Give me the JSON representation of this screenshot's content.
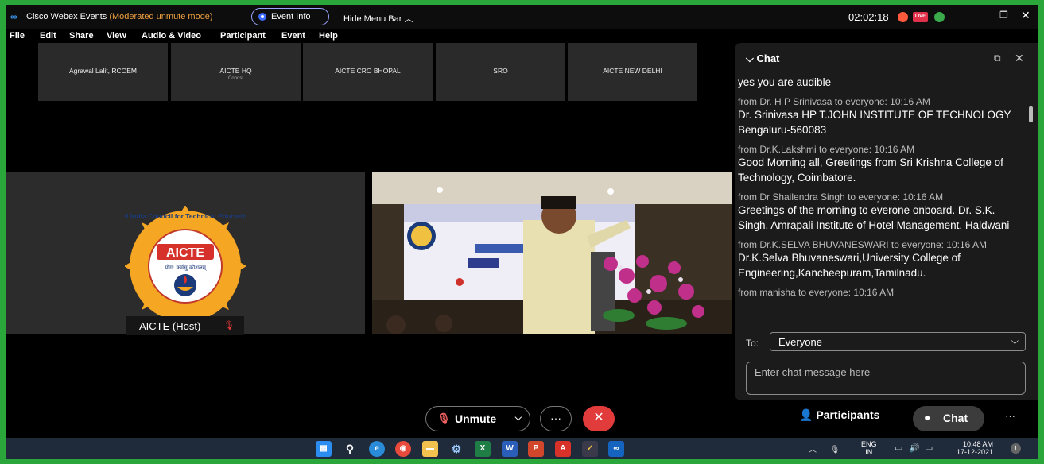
{
  "app": {
    "title": "Cisco Webex Events",
    "mode": "(Moderated unmute mode)",
    "event_info": "Event Info",
    "hide_menu": "Hide Menu Bar",
    "timer": "02:02:18",
    "live_badge": "LIVE"
  },
  "menu": [
    "File",
    "Edit",
    "Share",
    "View",
    "Audio & Video",
    "Participant",
    "Event",
    "Help"
  ],
  "thumbnails": [
    {
      "name": "Agrawal Lalit, RCOEM",
      "sub": ""
    },
    {
      "name": "AICTE HQ",
      "sub": "Cohost"
    },
    {
      "name": "AICTE CRO BHOPAL",
      "sub": ""
    },
    {
      "name": "SRO",
      "sub": ""
    },
    {
      "name": "AICTE NEW DELHI",
      "sub": ""
    }
  ],
  "stage": {
    "host_label": "AICTE (Host)",
    "logo_text": "AICTE",
    "logo_ring": "All India Council for Technical Education",
    "logo_motto": "योग: कर्मसु कौशलम्"
  },
  "chat": {
    "title": "Chat",
    "messages": [
      {
        "meta": "",
        "body": "yes you are audible"
      },
      {
        "meta": "from Dr. H P Srinivasa to everyone:   10:16 AM",
        "body": "Dr. Srinivasa HP T.JOHN INSTITUTE OF TECHNOLOGY Bengaluru-560083"
      },
      {
        "meta": "from Dr.K.Lakshmi to everyone:   10:16 AM",
        "body": "Good Morning all, Greetings from Sri Krishna College of Technology, Coimbatore."
      },
      {
        "meta": "from Dr Shailendra Singh to everyone:   10:16 AM",
        "body": "Greetings of the morning to everone onboard. Dr. S.K. Singh, Amrapali Institute of Hotel Management, Haldwani"
      },
      {
        "meta": "from Dr.K.SELVA BHUVANESWARI to everyone:   10:16 AM",
        "body": "Dr.K.Selva Bhuvaneswari,University College of Engineering,Kancheepuram,Tamilnadu."
      },
      {
        "meta": "from manisha to everyone:   10:16 AM",
        "body": ""
      }
    ],
    "to_label": "To:",
    "to_value": "Everyone",
    "input_placeholder": "Enter chat message here"
  },
  "controls": {
    "unmute": "Unmute",
    "participants": "Participants",
    "chat": "Chat"
  },
  "taskbar": {
    "apps": [
      "windows-start",
      "search",
      "edge-chromium",
      "chrome",
      "file-explorer",
      "settings",
      "excel",
      "word",
      "powerpoint",
      "acrobat",
      "webex-tasks",
      "webex"
    ],
    "lang": "ENG",
    "region": "IN",
    "time": "10:48 AM",
    "date": "17-12-2021",
    "notifications": "1"
  }
}
